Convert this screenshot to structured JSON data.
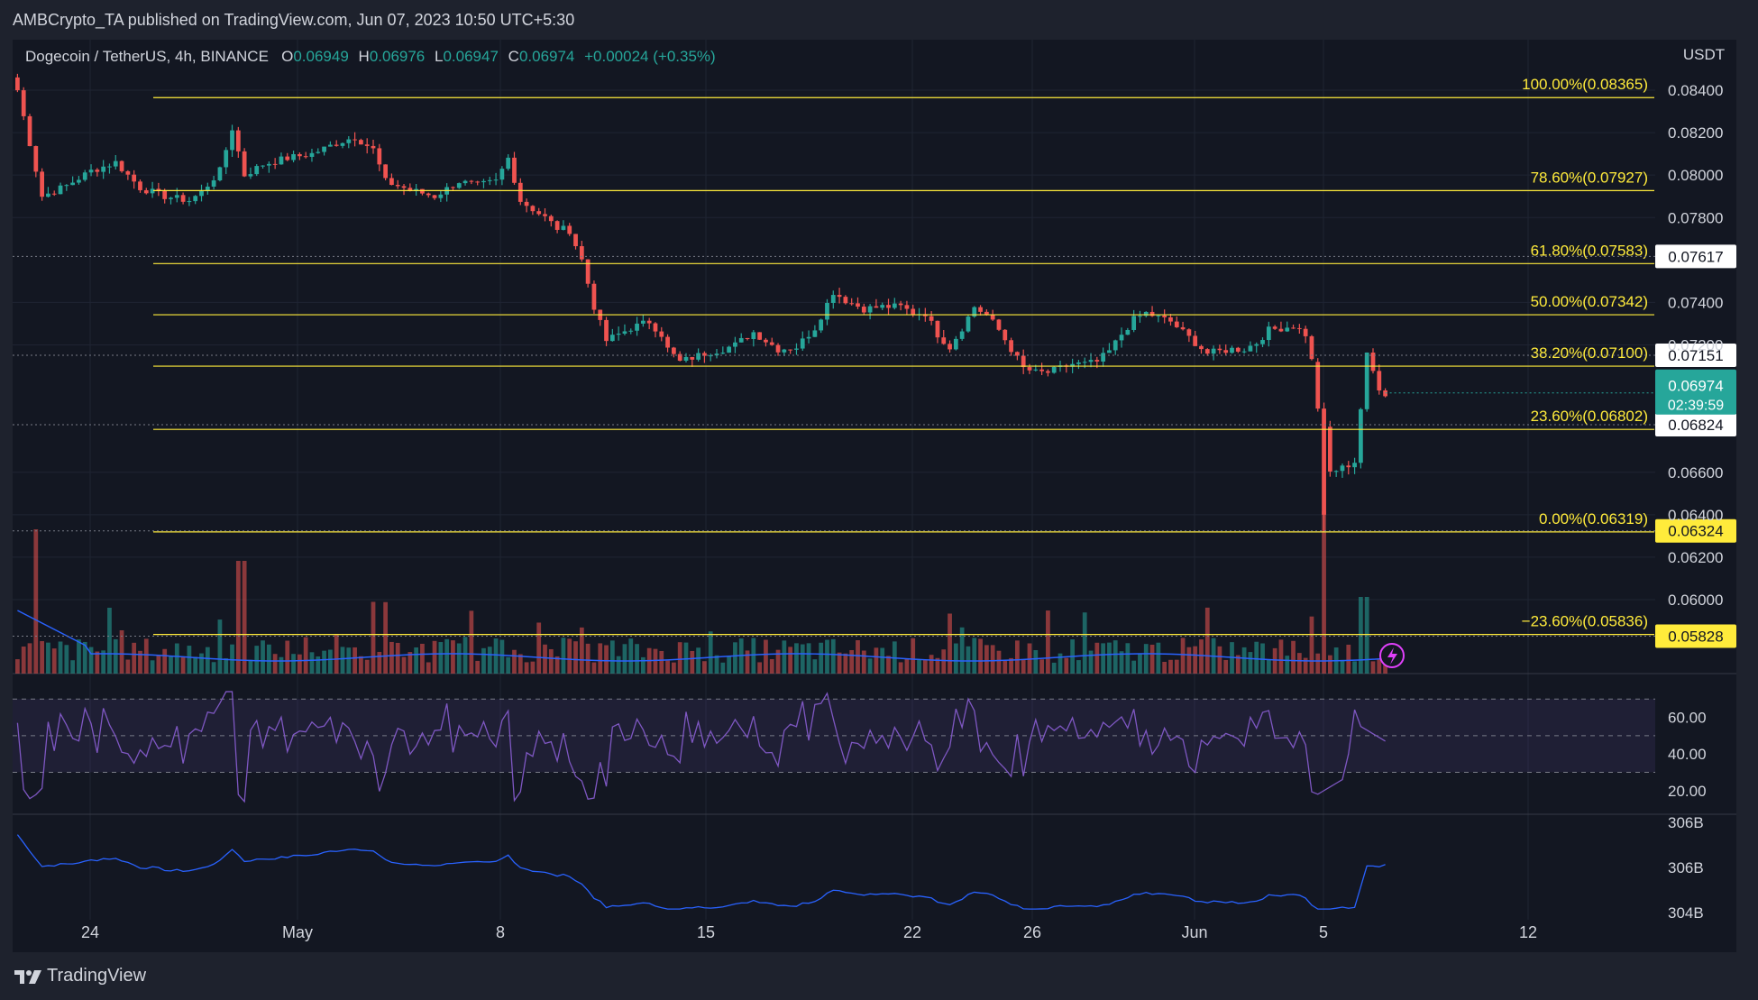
{
  "header": {
    "publisher": "AMBCrypto_TA published on TradingView.com, Jun 07, 2023 10:50 UTC+5:30"
  },
  "legend": {
    "symbol": "Dogecoin / TetherUS, 4h, BINANCE",
    "o_label": "O",
    "o_value": "0.06949",
    "h_label": "H",
    "h_value": "0.06976",
    "l_label": "L",
    "l_value": "0.06947",
    "c_label": "C",
    "c_value": "0.06974",
    "change": "+0.00024 (+0.35%)"
  },
  "footer": {
    "brand": "TradingView"
  },
  "colors": {
    "up": "#26a69a",
    "down": "#ef5350",
    "fib": "#ffeb3b",
    "rsi": "#7e57c2",
    "ma": "#2962ff",
    "bg": "#131722"
  },
  "chart_data": {
    "type": "candlestick",
    "timeframe": "4h",
    "symbol": "DOGE/USDT",
    "price_axis": {
      "label": "USDT",
      "ticks": [
        "0.08400",
        "0.08200",
        "0.08000",
        "0.07800",
        "0.07400",
        "0.07200",
        "0.06600",
        "0.06400",
        "0.06200",
        "0.06000"
      ],
      "range": [
        0.0575,
        0.0855
      ]
    },
    "x_axis": {
      "ticks": [
        "24",
        "May",
        "8",
        "15",
        "22",
        "26",
        "Jun",
        "5",
        "12"
      ]
    },
    "fibonacci_levels": [
      {
        "label": "100.00%(0.08365)",
        "price": 0.08365
      },
      {
        "label": "78.60%(0.07927)",
        "price": 0.07927
      },
      {
        "label": "61.80%(0.07583)",
        "price": 0.07583
      },
      {
        "label": "50.00%(0.07342)",
        "price": 0.07342
      },
      {
        "label": "38.20%(0.07100)",
        "price": 0.071
      },
      {
        "label": "23.60%(0.06802)",
        "price": 0.06802
      },
      {
        "label": "0.00%(0.06319)",
        "price": 0.06319
      },
      {
        "label": "−23.60%(0.05836)",
        "price": 0.05836
      }
    ],
    "price_tags": [
      {
        "text": "0.07617",
        "price": 0.07617,
        "style": "white"
      },
      {
        "text": "0.07151",
        "price": 0.07151,
        "style": "white"
      },
      {
        "text": "0.06824",
        "price": 0.06824,
        "style": "white"
      },
      {
        "text": "0.06324",
        "price": 0.06324,
        "style": "yellow"
      },
      {
        "text": "0.05828",
        "price": 0.05828,
        "style": "yellow"
      }
    ],
    "current_price": {
      "price": "0.06974",
      "countdown": "02:39:59",
      "value": 0.06974
    },
    "price_path": [
      [
        0,
        0.084
      ],
      [
        4,
        0.079
      ],
      [
        8,
        0.0795
      ],
      [
        12,
        0.0802
      ],
      [
        16,
        0.0806
      ],
      [
        20,
        0.0794
      ],
      [
        24,
        0.079
      ],
      [
        28,
        0.0788
      ],
      [
        30,
        0.0792
      ],
      [
        33,
        0.0802
      ],
      [
        35,
        0.0822
      ],
      [
        37,
        0.08
      ],
      [
        40,
        0.0805
      ],
      [
        44,
        0.0808
      ],
      [
        48,
        0.081
      ],
      [
        52,
        0.0815
      ],
      [
        55,
        0.0818
      ],
      [
        58,
        0.0812
      ],
      [
        60,
        0.0797
      ],
      [
        64,
        0.0793
      ],
      [
        68,
        0.079
      ],
      [
        72,
        0.0797
      ],
      [
        75,
        0.0795
      ],
      [
        78,
        0.0797
      ],
      [
        80,
        0.0808
      ],
      [
        82,
        0.0788
      ],
      [
        86,
        0.078
      ],
      [
        88,
        0.0775
      ],
      [
        90,
        0.0774
      ],
      [
        92,
        0.076
      ],
      [
        94,
        0.0738
      ],
      [
        96,
        0.0722
      ],
      [
        98,
        0.0725
      ],
      [
        100,
        0.0728
      ],
      [
        103,
        0.0731
      ],
      [
        105,
        0.0725
      ],
      [
        106,
        0.0718
      ],
      [
        108,
        0.0712
      ],
      [
        110,
        0.0714
      ],
      [
        112,
        0.0716
      ],
      [
        115,
        0.0718
      ],
      [
        117,
        0.072
      ],
      [
        120,
        0.0726
      ],
      [
        122,
        0.0722
      ],
      [
        124,
        0.0718
      ],
      [
        127,
        0.0719
      ],
      [
        130,
        0.0728
      ],
      [
        133,
        0.0745
      ],
      [
        135,
        0.0741
      ],
      [
        138,
        0.0737
      ],
      [
        141,
        0.0738
      ],
      [
        144,
        0.0738
      ],
      [
        146,
        0.0735
      ],
      [
        148,
        0.0735
      ],
      [
        150,
        0.0725
      ],
      [
        152,
        0.0719
      ],
      [
        154,
        0.0728
      ],
      [
        156,
        0.0738
      ],
      [
        158,
        0.0734
      ],
      [
        160,
        0.0727
      ],
      [
        162,
        0.0718
      ],
      [
        164,
        0.0709
      ],
      [
        166,
        0.0707
      ],
      [
        168,
        0.0707
      ],
      [
        170,
        0.0709
      ],
      [
        172,
        0.0711
      ],
      [
        174,
        0.0711
      ],
      [
        176,
        0.0712
      ],
      [
        178,
        0.0717
      ],
      [
        180,
        0.0725
      ],
      [
        182,
        0.0732
      ],
      [
        184,
        0.0735
      ],
      [
        186,
        0.0733
      ],
      [
        188,
        0.0731
      ],
      [
        190,
        0.0726
      ],
      [
        192,
        0.0721
      ],
      [
        194,
        0.0716
      ],
      [
        196,
        0.0717
      ],
      [
        198,
        0.0718
      ],
      [
        200,
        0.0718
      ],
      [
        202,
        0.0721
      ],
      [
        204,
        0.0727
      ],
      [
        206,
        0.0728
      ],
      [
        208,
        0.0729
      ],
      [
        210,
        0.0725
      ],
      [
        212,
        0.07
      ],
      [
        214,
        0.066
      ],
      [
        216,
        0.0662
      ],
      [
        218,
        0.0665
      ],
      [
        220,
        0.0715
      ],
      [
        222,
        0.07
      ],
      [
        223,
        0.0697
      ]
    ],
    "volume": {
      "label": "Volume",
      "ma_label": "Volume MA"
    },
    "rsi": {
      "label": "RSI",
      "ticks": [
        "60.00",
        "40.00",
        "20.00"
      ],
      "upper": 70,
      "lower": 30,
      "range": [
        12,
        76
      ]
    },
    "obv": {
      "label": "OBV",
      "ticks": [
        "306B",
        "306B",
        "304B"
      ],
      "values_B": [
        307.5,
        306.2,
        304.8
      ]
    }
  }
}
